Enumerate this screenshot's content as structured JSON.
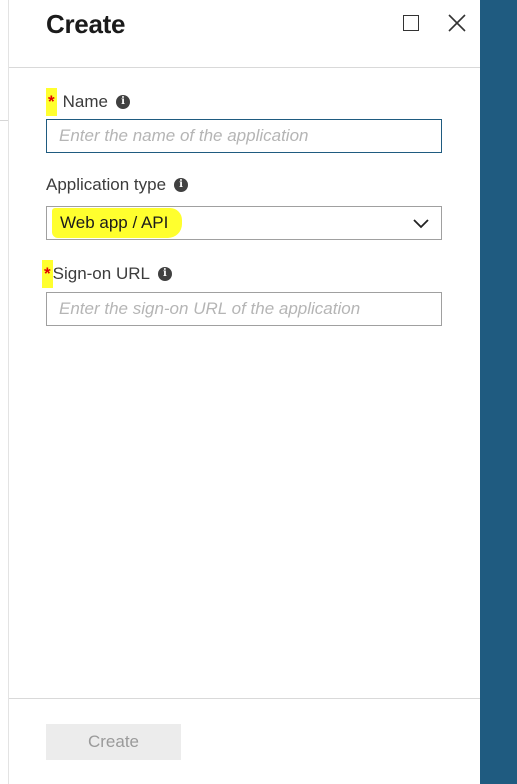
{
  "blade": {
    "title": "Create"
  },
  "form": {
    "name": {
      "required_marker": "*",
      "label": "Name",
      "placeholder": "Enter the name of the application",
      "value": ""
    },
    "application_type": {
      "label": "Application type",
      "selected": "Web app / API"
    },
    "sign_on_url": {
      "required_marker": "*",
      "label": "Sign-on URL",
      "placeholder": "Enter the sign-on URL of the application",
      "value": ""
    }
  },
  "footer": {
    "create_label": "Create"
  },
  "colors": {
    "accent": "#1f5b80",
    "highlight": "#ffff2e",
    "required": "#e00000"
  },
  "icons": {
    "info": "i"
  }
}
